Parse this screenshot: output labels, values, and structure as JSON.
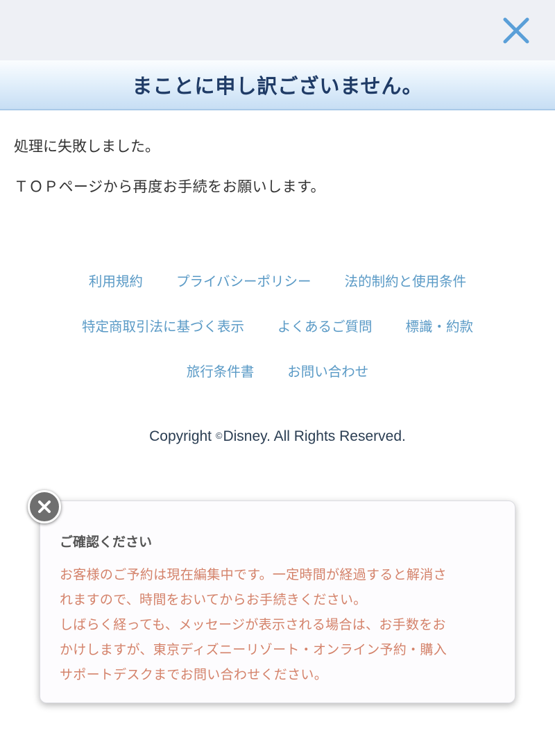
{
  "header": {
    "close_icon": "close-icon",
    "close_color": "#5a9fd8",
    "title": "まことに申し訳ございません。"
  },
  "messages": {
    "line1": "処理に失敗しました。",
    "line2": "ＴＯＰページから再度お手続をお願いします。"
  },
  "footer": {
    "links": [
      "利用規約",
      "プライバシーポリシー",
      "法的制約と使用条件",
      "特定商取引法に基づく表示",
      "よくあるご質問",
      "標識・約款",
      "旅行条件書",
      "お問い合わせ"
    ],
    "copyright_symbol": "©",
    "copyright_prefix": "Copyright ",
    "copyright_text": "Disney. All Rights Reserved."
  },
  "notice": {
    "close_icon": "close-icon",
    "title": "ご確認ください",
    "lines": [
      "お客様のご予約は現在編集中です。一定時間が経過すると解消さ",
      "れますので、時間をおいてからお手続きください。",
      "しばらく経っても、メッセージが表示される場合は、お手数をお",
      "かけしますが、東京ディズニーリゾート・オンライン予約・購入",
      "サポートデスクまでお問い合わせください。"
    ],
    "text_color": "#d4826a"
  }
}
